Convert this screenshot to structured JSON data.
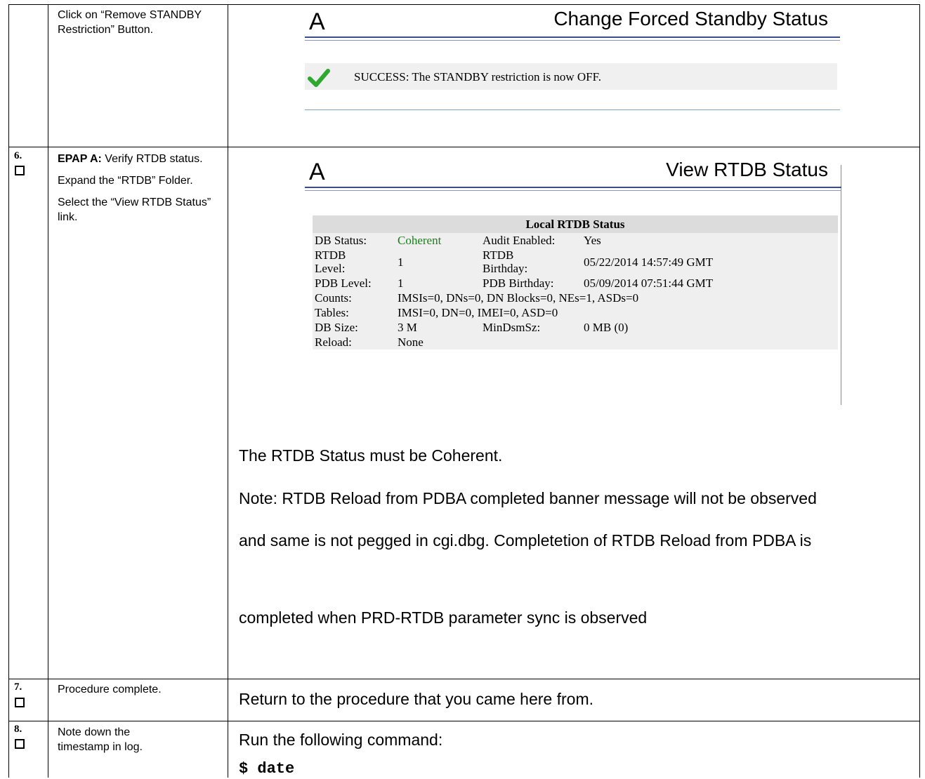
{
  "step_prev": {
    "description": "Click on “Remove STANDBY Restriction” Button.",
    "screenshot": {
      "page_letter": "A",
      "title": "Change Forced Standby Status",
      "message": "SUCCESS: The STANDBY restriction is now OFF.",
      "message_icon": "check-icon",
      "icon_color": "#2ea82e"
    }
  },
  "step6": {
    "number": "6.",
    "desc_bold": "EPAP A:",
    "desc_rest": " Verify RTDB status.",
    "desc_p2": "Expand the “RTDB” Folder.",
    "desc_p3": "Select the “View RTDB Status” link.",
    "screenshot": {
      "page_letter": "A",
      "title": "View RTDB Status",
      "table_title": "Local RTDB Status",
      "db_status_label": "DB Status:",
      "db_status_value": "Coherent",
      "coherent_color": "#1a7f1a",
      "audit_label": "Audit Enabled:",
      "audit_value": "Yes",
      "rtdb_level_label_1": "RTDB",
      "rtdb_level_label_2": "Level:",
      "rtdb_level_value": "1",
      "rtdb_birthday_label_1": "RTDB",
      "rtdb_birthday_label_2": "Birthday:",
      "rtdb_birthday_value": "05/22/2014 14:57:49 GMT",
      "pdb_level_label": "PDB Level:",
      "pdb_level_value": "1",
      "pdb_birthday_label": "PDB Birthday:",
      "pdb_birthday_value": "05/09/2014 07:51:44 GMT",
      "counts_label": "Counts:",
      "counts_value": "IMSIs=0, DNs=0, DN Blocks=0, NEs=1, ASDs=0",
      "tables_label": "Tables:",
      "tables_value": "IMSI=0, DN=0, IMEI=0, ASD=0",
      "db_size_label": "DB Size:",
      "db_size_value": "3 M",
      "mindsm_label": "MinDsmSz:",
      "mindsm_value": "0 MB (0)",
      "reload_label": "Reload:",
      "reload_value": "None"
    },
    "text_coherent": "The RTDB Status must be Coherent.",
    "note_line1": "Note: RTDB Reload from PDBA completed banner message will not be observed",
    "note_line2": "and same is not pegged in cgi.dbg. Completetion of RTDB Reload from PDBA is",
    "note_line3": "completed when PRD-RTDB parameter sync is observed"
  },
  "step7": {
    "number": "7.",
    "description": "Procedure complete.",
    "text": "Return to the procedure that you came here from."
  },
  "step8": {
    "number": "8.",
    "description": "Note down the timestamp in log.",
    "text": "Run the following command:",
    "command": "$ date"
  }
}
